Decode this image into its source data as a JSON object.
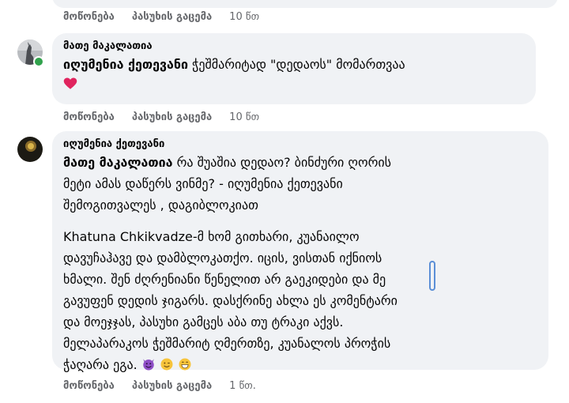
{
  "actions": {
    "like": "მოწონება",
    "reply": "პასუხის გაცემა"
  },
  "top_action_time": "10 წთ",
  "comment1": {
    "author": "მათე მაკალათია",
    "mention": "იღუმენია ქეთევანი",
    "text": " ჭეშმარიტად \"დედაოს\" მომართვაა",
    "time": "10 წთ"
  },
  "comment2": {
    "author": "იღუმენია ქეთევანი",
    "mention": "მათე მაკალათია",
    "lines_p1": [
      " რა შუაშია დედაო? ბინძური ღორის",
      "მეტი ამას დაწერს ვინმე? - იღუმენია ქეთევანი",
      "შემოგითვალეს , დაგიბლოკიათ"
    ],
    "lines_p2": [
      "Khatuna Chkikvadze-მ ხომ გითხარი, კუანაილო",
      "დავუჩაჰავე და დამბლოკათქო. იცის, ვისთან იქნიოს",
      "ხმალი. შენ ძღრენიანი წენელით არ გაეკიდები და მე",
      "გავუფენ დედის ჯიგარს. დასქრინე ახლა ეს კომენტარი",
      "და მოეჯჯას, პასუხი გამცეს აბა თუ ტრაკი აქვს.",
      "მელაპარაკოს ჭეშმარიტ ღმერთზე, კუანალოს პროჭის",
      "ჭაღარა ეგა."
    ],
    "time": "1 წთ."
  },
  "icons": {
    "heart": "red-heart-icon",
    "devil": "smiling-devil-icon",
    "wink": "winking-face-icon",
    "grin": "grinning-face-icon"
  }
}
